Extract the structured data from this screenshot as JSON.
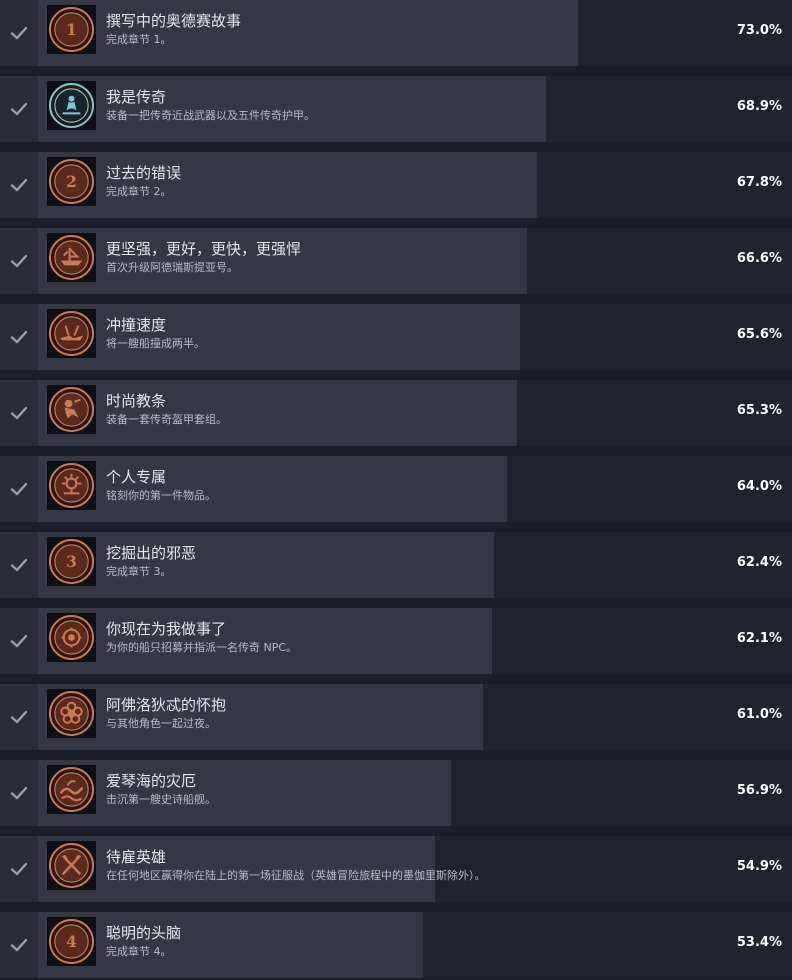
{
  "colors": {
    "page_bg": "#1b1e26",
    "row_bg": "#20232b",
    "row_fill": "#353844",
    "check_bg": "#2a2d36",
    "check": "#9aa0aa",
    "bronze": "#c77a57",
    "bronze_dark": "#5a2a1c",
    "teal": "#7fc7d3"
  },
  "achievements": [
    {
      "title": "撰写中的奥德赛故事",
      "desc": "完成章节 1。",
      "percent": "73.0%",
      "fraction": 0.73,
      "icon": "chapter-1-medal-icon",
      "numeral": "1"
    },
    {
      "title": "我是传奇",
      "desc": "装备一把传奇近战武器以及五件传奇护甲。",
      "percent": "68.9%",
      "fraction": 0.689,
      "icon": "legend-statue-icon",
      "numeral": ""
    },
    {
      "title": "过去的错误",
      "desc": "完成章节 2。",
      "percent": "67.8%",
      "fraction": 0.678,
      "icon": "chapter-2-medal-icon",
      "numeral": "2"
    },
    {
      "title": "更坚强，更好，更快，更强悍",
      "desc": "首次升级阿德瑞斯提亚号。",
      "percent": "66.6%",
      "fraction": 0.666,
      "icon": "ship-upgrade-icon",
      "numeral": ""
    },
    {
      "title": "冲撞速度",
      "desc": "将一艘船撞成两半。",
      "percent": "65.6%",
      "fraction": 0.656,
      "icon": "ship-ram-icon",
      "numeral": ""
    },
    {
      "title": "时尚教条",
      "desc": "装备一套传奇盔甲套组。",
      "percent": "65.3%",
      "fraction": 0.653,
      "icon": "armor-set-icon",
      "numeral": ""
    },
    {
      "title": "个人专属",
      "desc": "铭刻你的第一件物品。",
      "percent": "64.0%",
      "fraction": 0.64,
      "icon": "engrave-icon",
      "numeral": ""
    },
    {
      "title": "挖掘出的邪恶",
      "desc": "完成章节 3。",
      "percent": "62.4%",
      "fraction": 0.624,
      "icon": "chapter-3-medal-icon",
      "numeral": "3"
    },
    {
      "title": "你现在为我做事了",
      "desc": "为你的船只招募并指派一名传奇 NPC。",
      "percent": "62.1%",
      "fraction": 0.621,
      "icon": "recruit-icon",
      "numeral": ""
    },
    {
      "title": "阿佛洛狄忒的怀抱",
      "desc": "与其他角色一起过夜。",
      "percent": "61.0%",
      "fraction": 0.61,
      "icon": "rose-icon",
      "numeral": ""
    },
    {
      "title": "爱琴海的灾厄",
      "desc": "击沉第一艘史诗船舰。",
      "percent": "56.9%",
      "fraction": 0.569,
      "icon": "sea-wave-icon",
      "numeral": ""
    },
    {
      "title": "待雇英雄",
      "desc": "在任何地区赢得你在陆上的第一场征服战（英雄冒险旅程中的墨伽里斯除外）。",
      "percent": "54.9%",
      "fraction": 0.549,
      "icon": "crossed-axes-icon",
      "numeral": ""
    },
    {
      "title": "聪明的头脑",
      "desc": "完成章节 4。",
      "percent": "53.4%",
      "fraction": 0.534,
      "icon": "chapter-4-medal-icon",
      "numeral": "4"
    }
  ]
}
